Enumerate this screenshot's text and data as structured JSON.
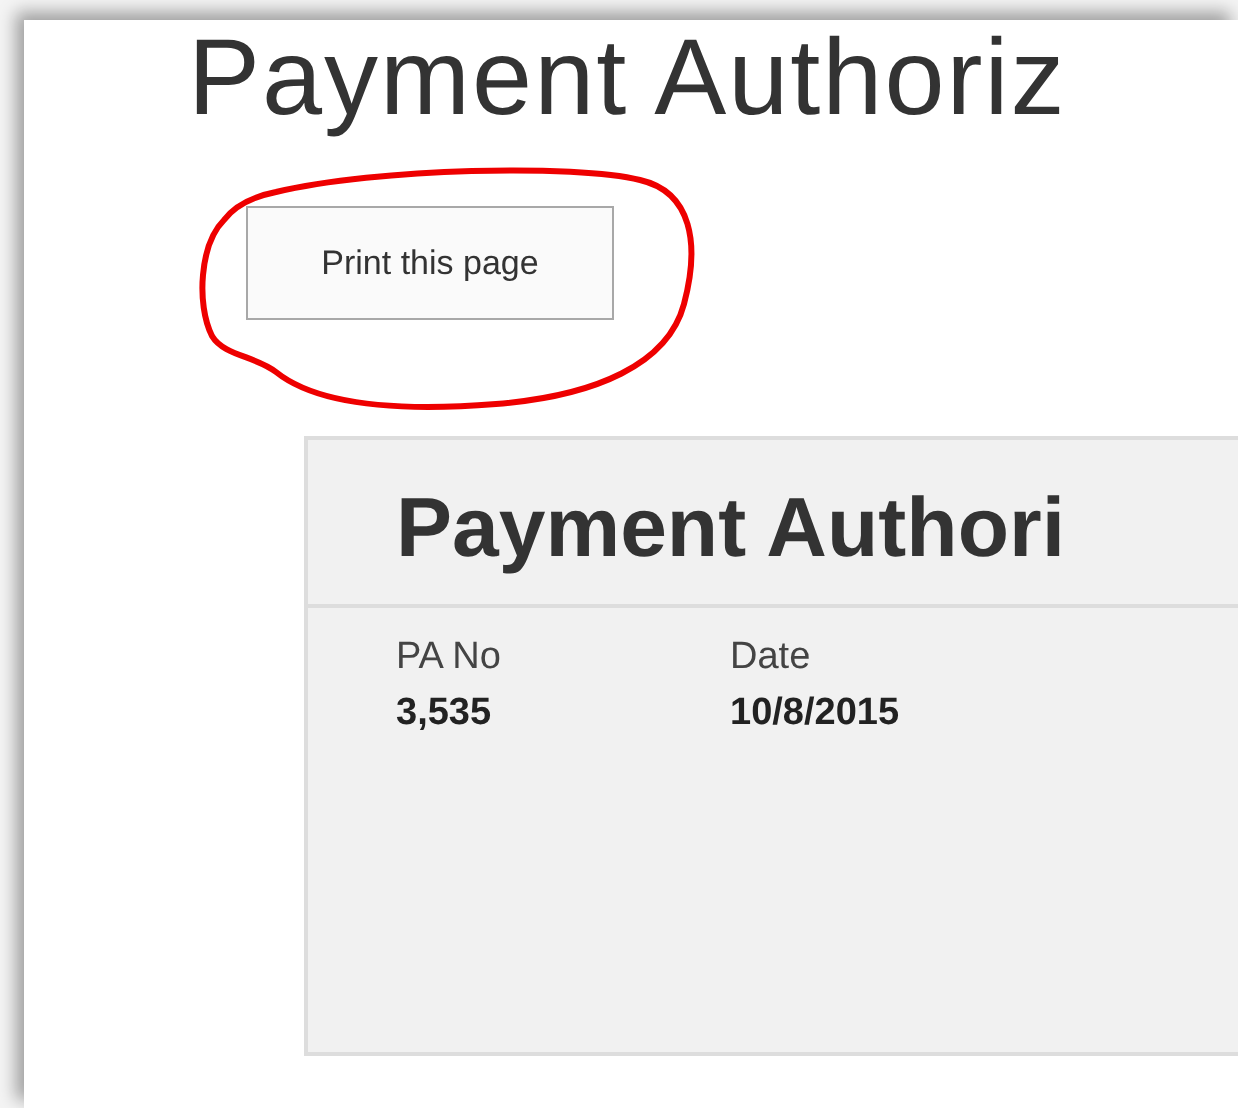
{
  "page_title": "Payment Authoriz",
  "print_button": {
    "label": "Print this page"
  },
  "card": {
    "title": "Payment Authori",
    "fields": [
      {
        "label": "PA No",
        "value": "3,535"
      },
      {
        "label": "Date",
        "value": "10/8/2015"
      }
    ]
  }
}
